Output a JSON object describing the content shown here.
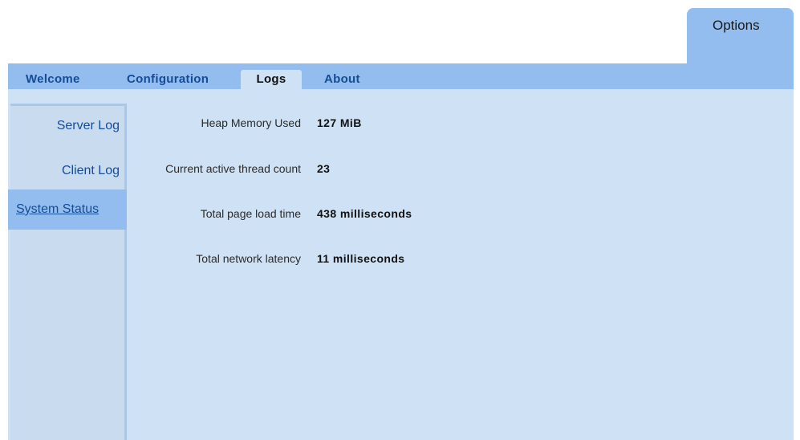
{
  "options_tab": {
    "label": "Options"
  },
  "tabs": [
    {
      "label": "Welcome",
      "active": false
    },
    {
      "label": "Configuration",
      "active": false
    },
    {
      "label": "Logs",
      "active": true
    },
    {
      "label": "About",
      "active": false
    }
  ],
  "sidebar": {
    "items": [
      {
        "label": "Server Log",
        "selected": false
      },
      {
        "label": "Client Log",
        "selected": false
      },
      {
        "label": "System Status",
        "selected": true
      }
    ]
  },
  "metrics": [
    {
      "label": "Heap Memory Used",
      "value": "127 MiB"
    },
    {
      "label": "Current active thread count",
      "value": "23"
    },
    {
      "label": "Total page load time",
      "value": "438 milliseconds"
    },
    {
      "label": "Total network latency",
      "value": "11 milliseconds"
    }
  ],
  "colors": {
    "tab_bar": "#93bdee",
    "panel_background": "#cfe2f5",
    "link_text": "#154c96"
  }
}
